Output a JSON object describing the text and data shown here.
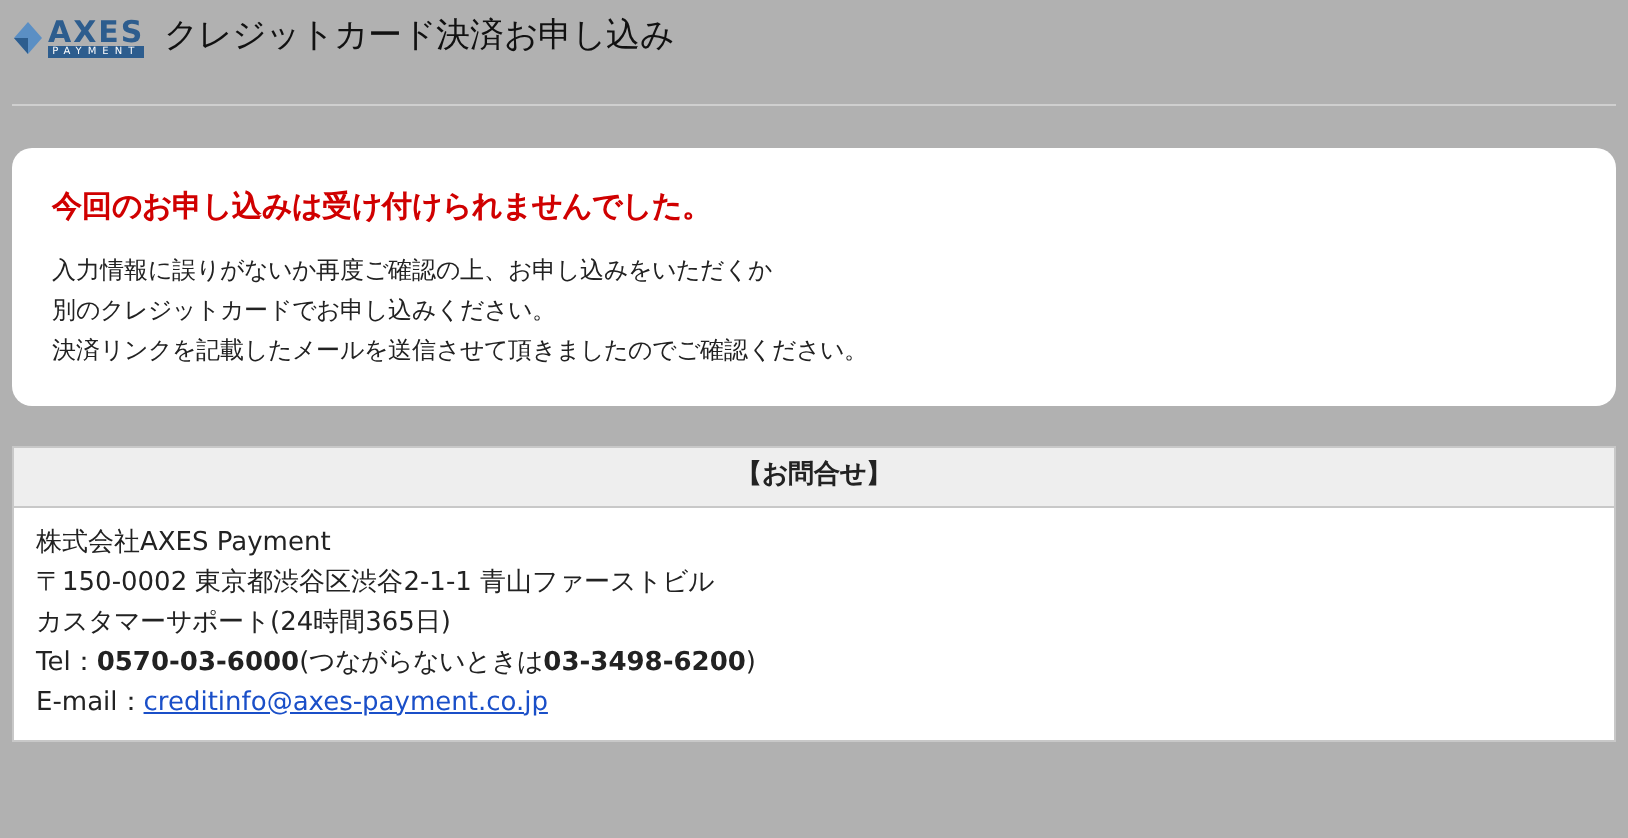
{
  "header": {
    "logo": {
      "name": "AXES",
      "tagline": "PAYMENT"
    },
    "title": "クレジットカード決済お申し込み"
  },
  "error_card": {
    "heading": "今回のお申し込みは受け付けられませんでした。",
    "lines": [
      "入力情報に誤りがないか再度ご確認の上、お申し込みをいただくか",
      "別のクレジットカードでお申し込みください。",
      "決済リンクを記載したメールを送信させて頂きましたのでご確認ください。"
    ]
  },
  "contact": {
    "heading": "【お問合せ】",
    "lines": [
      "株式会社AXES Payment",
      "〒150-0002 東京都渋谷区渋谷2-1-1 青山ファーストビル",
      "カスタマーサポート(24時間365日)",
      "Tel：**0570-03-6000**(つながらないときは**03-3498-6200**)"
    ],
    "email_label": "E-mail：",
    "email": "creditinfo@axes-payment.co.jp"
  }
}
